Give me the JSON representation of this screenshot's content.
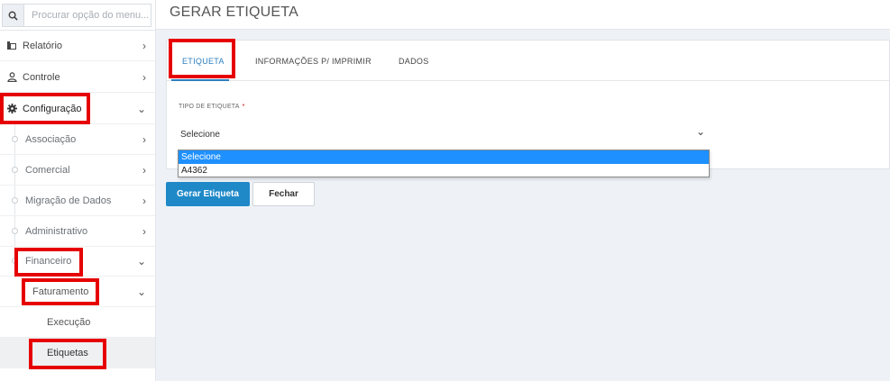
{
  "sidebar": {
    "search_placeholder": "Procurar opção do menu...",
    "items": {
      "relatorio": "Relatório",
      "controle": "Controle",
      "configuracao": "Configuração",
      "associacao": "Associação",
      "comercial": "Comercial",
      "migracao": "Migração de Dados",
      "administrativo": "Administrativo",
      "financeiro": "Financeiro",
      "faturamento": "Faturamento",
      "execucao": "Execução",
      "etiquetas": "Etiquetas"
    },
    "icons": {
      "search": "search-icon",
      "relatorio": "chart-icon",
      "controle": "user-icon",
      "configuracao": "gear-icon"
    }
  },
  "page": {
    "title": "GERAR ETIQUETA"
  },
  "tabs": {
    "etiqueta": "ETIQUETA",
    "informacoes": "INFORMAÇÕES P/ IMPRIMIR",
    "dados": "DADOS"
  },
  "form": {
    "tipo_label": "TIPO DE ETIQUETA",
    "required_mark": "*",
    "selected_value": "Selecione",
    "options": [
      "Selecione",
      "A4362"
    ]
  },
  "buttons": {
    "gerar": "Gerar Etiqueta",
    "fechar": "Fechar"
  },
  "colors": {
    "accent": "#1f89c8",
    "tab_active": "#2d7fbf",
    "highlight": "#e60000",
    "option_selected": "#1e90ff"
  }
}
